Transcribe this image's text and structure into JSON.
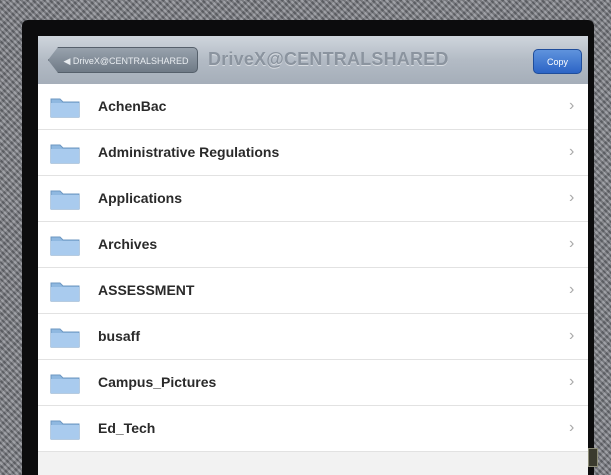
{
  "navbar": {
    "back_label": "◀ DriveX@CENTRALSHARED",
    "title": "DriveX@CENTRALSHARED",
    "copy_label": "Copy"
  },
  "folders": [
    {
      "label": "AchenBac",
      "icon": "folder-icon"
    },
    {
      "label": "Administrative Regulations",
      "icon": "folder-icon"
    },
    {
      "label": "Applications",
      "icon": "folder-icon"
    },
    {
      "label": "Archives",
      "icon": "folder-icon"
    },
    {
      "label": "ASSESSMENT",
      "icon": "folder-icon"
    },
    {
      "label": "busaff",
      "icon": "folder-icon"
    },
    {
      "label": "Campus_Pictures",
      "icon": "folder-icon"
    },
    {
      "label": "Ed_Tech",
      "icon": "folder-icon"
    }
  ],
  "colors": {
    "accent": "#2c64c6",
    "folder": "#8fb8e0",
    "navbar": "#b3bbc5"
  }
}
